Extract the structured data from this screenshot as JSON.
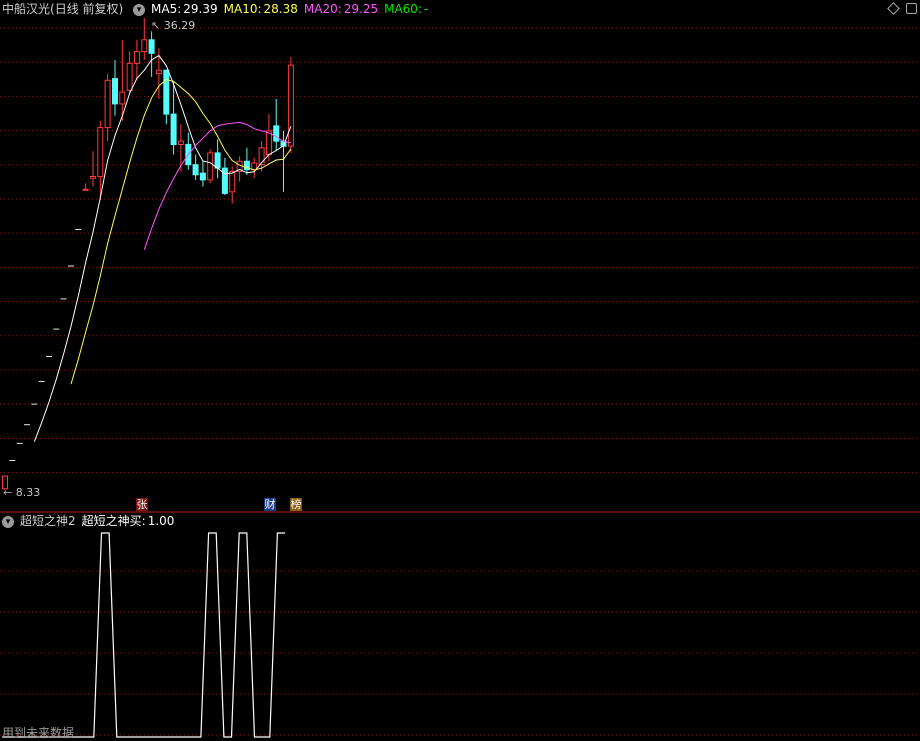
{
  "header": {
    "stock_name": "中船汉光",
    "period": "(日线 前复权)",
    "ma5_label": "MA5:",
    "ma5_value": "29.39",
    "ma10_label": "MA10:",
    "ma10_value": "28.38",
    "ma20_label": "MA20:",
    "ma20_value": "29.25",
    "ma60_label": "MA60:",
    "ma60_value": "-"
  },
  "annotations": {
    "high_price": "36.29",
    "low_price": "8.33",
    "tag_zhang": "张",
    "tag_cai": "财",
    "tag_bang": "榜"
  },
  "indicator": {
    "name": "超短之神2",
    "series_label": "超短之神买:",
    "series_value": "1.00",
    "footer_note": "用到未来数据"
  },
  "colors": {
    "up": "#ff3b3b",
    "down": "#54fcfc",
    "ma5": "#ffffff",
    "ma10": "#ffff54",
    "ma20": "#ff54ff",
    "ma60": "#00e600",
    "grid": "#8b1a1a",
    "divider": "#b02020"
  },
  "icons": {
    "dropdown": "chevron-down-icon",
    "diamond": "diamond-icon",
    "restore": "restore-icon"
  },
  "chart_data": [
    {
      "type": "candlestick",
      "ylim": [
        8.33,
        36.29
      ],
      "candles": [
        {
          "o": 8.4,
          "h": 9.16,
          "l": 8.33,
          "c": 9.16
        },
        {
          "o": 10.08,
          "h": 10.08,
          "l": 10.08,
          "c": 10.08
        },
        {
          "o": 11.09,
          "h": 11.09,
          "l": 11.09,
          "c": 11.09
        },
        {
          "o": 12.2,
          "h": 12.2,
          "l": 12.2,
          "c": 12.2
        },
        {
          "o": 13.42,
          "h": 13.42,
          "l": 13.42,
          "c": 13.42
        },
        {
          "o": 14.76,
          "h": 14.76,
          "l": 14.76,
          "c": 14.76
        },
        {
          "o": 16.24,
          "h": 16.24,
          "l": 16.24,
          "c": 16.24
        },
        {
          "o": 17.86,
          "h": 17.86,
          "l": 17.86,
          "c": 17.86
        },
        {
          "o": 19.65,
          "h": 19.65,
          "l": 19.65,
          "c": 19.65
        },
        {
          "o": 21.6,
          "h": 21.6,
          "l": 21.6,
          "c": 21.6
        },
        {
          "o": 23.76,
          "h": 23.76,
          "l": 23.76,
          "c": 23.76
        },
        {
          "o": 26.14,
          "h": 26.5,
          "l": 26.14,
          "c": 26.14
        },
        {
          "o": 26.8,
          "h": 28.4,
          "l": 26.3,
          "c": 26.9
        },
        {
          "o": 26.9,
          "h": 30.2,
          "l": 25.5,
          "c": 29.8
        },
        {
          "o": 29.8,
          "h": 33.0,
          "l": 29.0,
          "c": 32.6
        },
        {
          "o": 32.7,
          "h": 33.8,
          "l": 30.5,
          "c": 31.2
        },
        {
          "o": 31.2,
          "h": 35.0,
          "l": 30.2,
          "c": 31.9
        },
        {
          "o": 32.0,
          "h": 34.3,
          "l": 31.8,
          "c": 33.6
        },
        {
          "o": 33.6,
          "h": 35.0,
          "l": 32.6,
          "c": 34.3
        },
        {
          "o": 34.3,
          "h": 36.29,
          "l": 33.8,
          "c": 35.0
        },
        {
          "o": 35.0,
          "h": 35.5,
          "l": 32.8,
          "c": 34.2
        },
        {
          "o": 33.0,
          "h": 34.5,
          "l": 31.5,
          "c": 33.2
        },
        {
          "o": 33.2,
          "h": 33.2,
          "l": 30.0,
          "c": 30.6
        },
        {
          "o": 30.6,
          "h": 32.5,
          "l": 28.2,
          "c": 28.8
        },
        {
          "o": 28.8,
          "h": 30.0,
          "l": 27.2,
          "c": 29.0
        },
        {
          "o": 28.8,
          "h": 29.5,
          "l": 27.3,
          "c": 27.6
        },
        {
          "o": 27.6,
          "h": 28.2,
          "l": 26.7,
          "c": 27.0
        },
        {
          "o": 27.1,
          "h": 27.8,
          "l": 26.3,
          "c": 26.7
        },
        {
          "o": 26.7,
          "h": 28.5,
          "l": 26.5,
          "c": 28.3
        },
        {
          "o": 28.3,
          "h": 29.1,
          "l": 26.8,
          "c": 27.4
        },
        {
          "o": 27.4,
          "h": 28.0,
          "l": 25.8,
          "c": 25.9
        },
        {
          "o": 26.0,
          "h": 27.5,
          "l": 25.3,
          "c": 27.2
        },
        {
          "o": 27.2,
          "h": 28.1,
          "l": 26.6,
          "c": 27.8
        },
        {
          "o": 27.8,
          "h": 28.6,
          "l": 27.0,
          "c": 27.3
        },
        {
          "o": 27.3,
          "h": 28.0,
          "l": 26.8,
          "c": 27.7
        },
        {
          "o": 27.6,
          "h": 29.0,
          "l": 27.2,
          "c": 28.6
        },
        {
          "o": 28.2,
          "h": 30.6,
          "l": 27.8,
          "c": 29.6
        },
        {
          "o": 29.9,
          "h": 31.5,
          "l": 28.4,
          "c": 29.0
        },
        {
          "o": 29.0,
          "h": 29.6,
          "l": 26.0,
          "c": 28.7
        },
        {
          "o": 28.7,
          "h": 34.0,
          "l": 28.3,
          "c": 33.5
        }
      ]
    },
    {
      "type": "line",
      "name": "超短之神买",
      "ylim": [
        0,
        1
      ],
      "values": [
        0,
        0,
        0,
        0,
        0,
        0,
        0,
        0,
        0,
        0,
        0,
        0,
        0,
        1,
        1,
        0,
        0,
        0,
        0,
        0,
        0,
        0,
        0,
        0,
        0,
        0,
        0,
        1,
        1,
        0,
        0,
        1,
        1,
        0,
        0,
        0,
        1,
        1
      ]
    }
  ]
}
